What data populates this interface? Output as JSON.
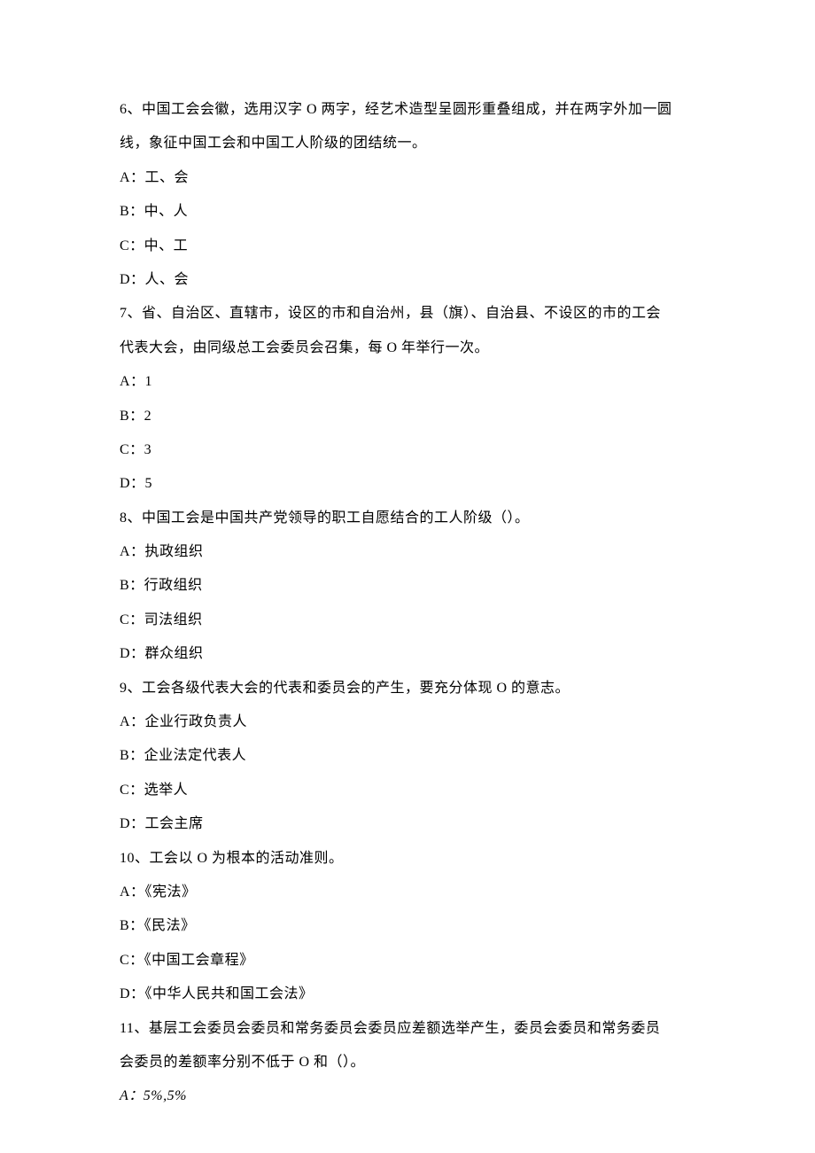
{
  "questions": [
    {
      "stem_lines": [
        "6、中国工会会徽，选用汉字 O 两字，经艺术造型呈圆形重叠组成，并在两字外加一圆",
        "线，象征中国工会和中国工人阶级的团结统一。"
      ],
      "options": [
        "A：工、会",
        "B：中、人",
        "C：中、工",
        "D：人、会"
      ]
    },
    {
      "stem_lines": [
        "7、省、自治区、直辖市，设区的市和自治州，县（旗）、自治县、不设区的市的工会",
        "代表大会，由同级总工会委员会召集，每 O 年举行一次。"
      ],
      "options": [
        "A：1",
        "B：2",
        "C：3",
        "D：5"
      ]
    },
    {
      "stem_lines": [
        "8、中国工会是中国共产党领导的职工自愿结合的工人阶级（）。"
      ],
      "options": [
        "A：执政组织",
        "B：行政组织",
        "C：司法组织",
        "D：群众组织"
      ]
    },
    {
      "stem_lines": [
        "9、工会各级代表大会的代表和委员会的产生，要充分体现 O 的意志。"
      ],
      "options": [
        "A：企业行政负责人",
        "B：企业法定代表人",
        "C：选举人",
        "D：工会主席"
      ]
    },
    {
      "stem_lines": [
        "10、工会以 O 为根本的活动准则。"
      ],
      "options": [
        "A：《宪法》",
        "B：《民法》",
        "C：《中国工会章程》",
        "D：《中华人民共和国工会法》"
      ]
    },
    {
      "stem_lines": [
        "11、基层工会委员会委员和常务委员会委员应差额选举产生，委员会委员和常务委员",
        "会委员的差额率分别不低于 O 和（）。"
      ],
      "options": [
        "A：5%,5%"
      ],
      "options_italic": true
    }
  ]
}
